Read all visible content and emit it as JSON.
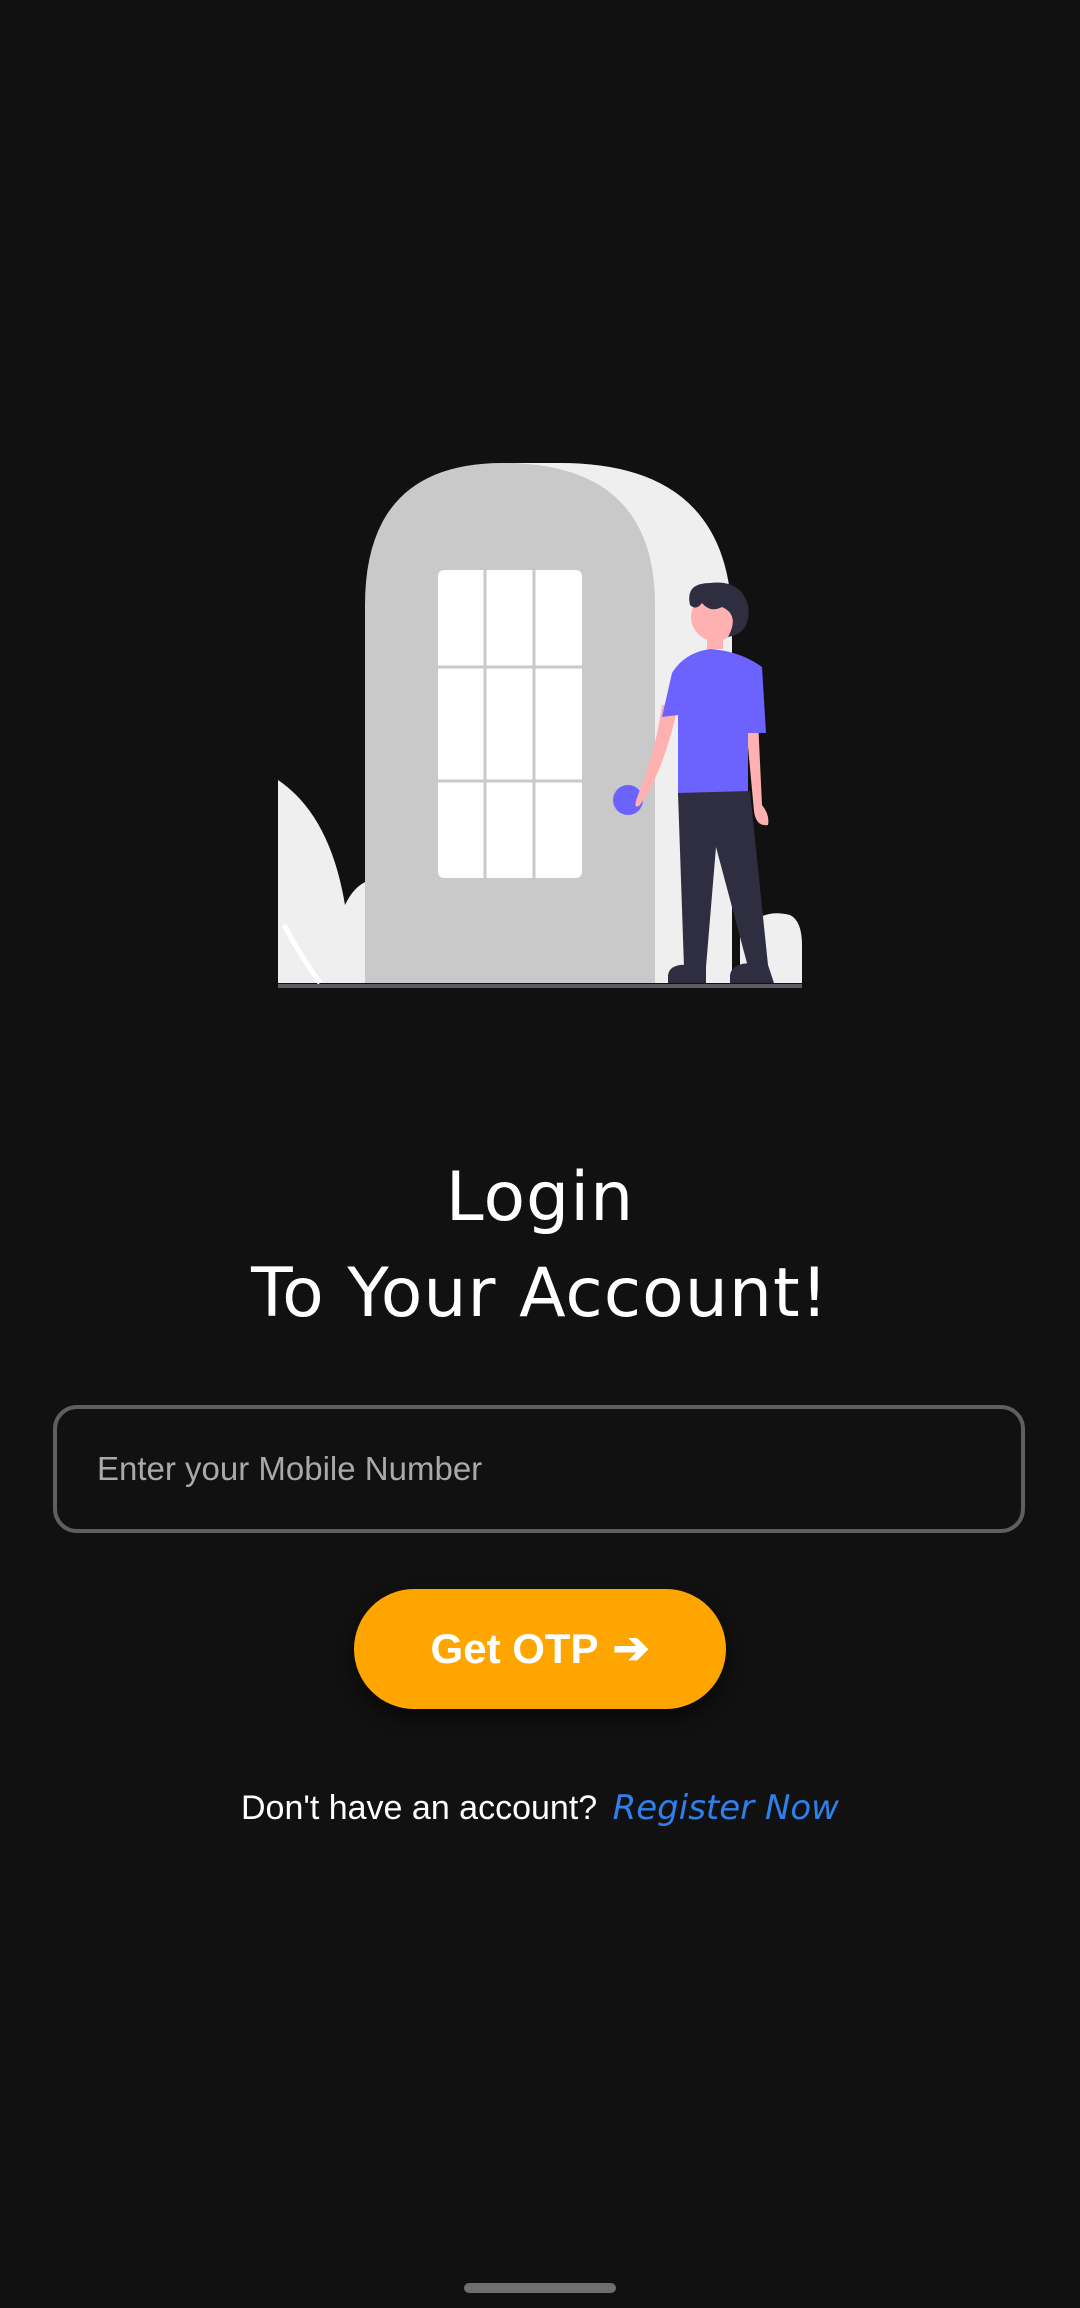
{
  "colors": {
    "background": "#111111",
    "accent": "#ffa500",
    "link": "#2f80ed",
    "field_border": "#5f5f5f",
    "person_shirt": "#6c63ff"
  },
  "illustration": {
    "name": "person-at-door-illustration"
  },
  "title": {
    "line1": "Login",
    "line2": "To Your Account!"
  },
  "mobile_input": {
    "value": "",
    "placeholder": "Enter your Mobile Number"
  },
  "otp_button": {
    "label": "Get OTP",
    "icon": "arrow-right-icon",
    "arrow": "➔"
  },
  "register": {
    "prompt": "Don't have an account?",
    "link_label": "Register Now"
  }
}
